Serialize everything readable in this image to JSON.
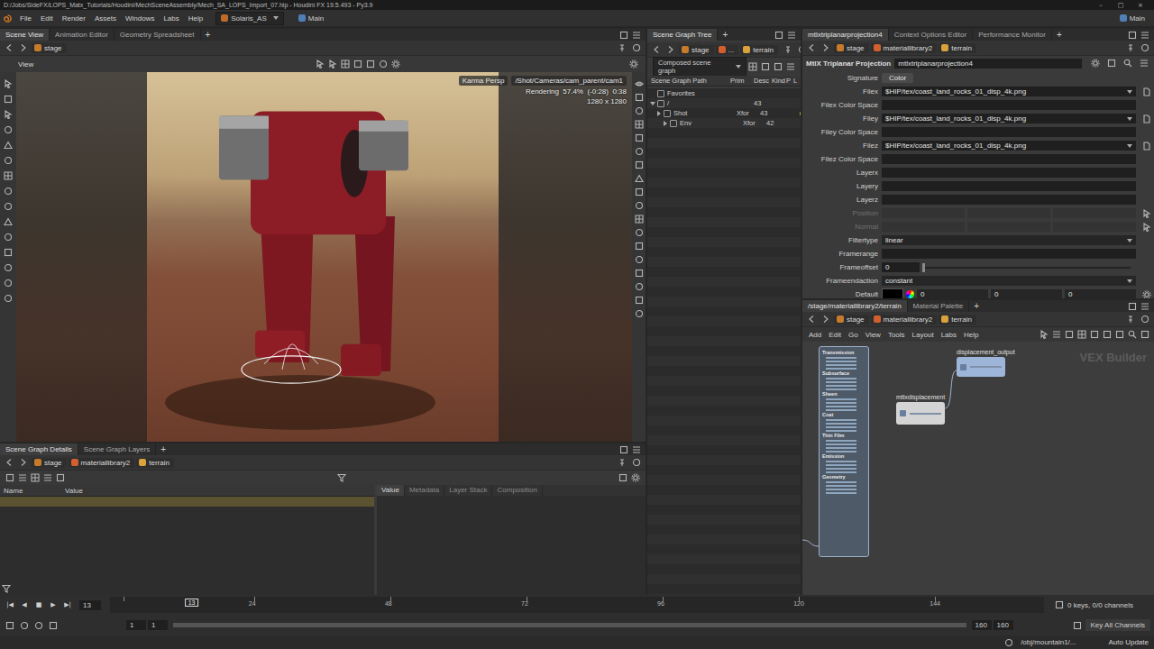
{
  "window": {
    "title": "D:/Jobs/SideFX/LOPS_Matx_Tutorials/Houdini/MechSceneAssembly/Mech_SA_LOPS_Import_07.hip - Houdini FX 19.5.493 - Py3.9",
    "controls": [
      "–",
      "□",
      "×"
    ]
  },
  "menu": {
    "items": [
      "File",
      "Edit",
      "Render",
      "Assets",
      "Windows",
      "Labs",
      "Help"
    ],
    "desktop": "Solaris_AS",
    "workspace": "Main",
    "workspace_right": "Main"
  },
  "scene_view": {
    "tabs": [
      {
        "label": "Scene View",
        "selected": true
      },
      {
        "label": "Animation Editor",
        "selected": false
      },
      {
        "label": "Geometry Spreadsheet",
        "selected": false
      }
    ],
    "add_tab": "+",
    "path": [
      "stage"
    ],
    "toolbar_label": "View",
    "overlay": {
      "camera_mode": "Karma Persp",
      "camera": "/Shot/Cameras/cam_parent/cam1",
      "status": "Rendering  57.4%  (-0:28)  0:38",
      "resolution": "1280 x 1280"
    }
  },
  "scene_graph_details": {
    "tabs": [
      {
        "label": "Scene Graph Details",
        "selected": true
      },
      {
        "label": "Scene Graph Layers",
        "selected": false
      }
    ],
    "add_tab": "+",
    "path": [
      "stage",
      "materiallibrary2",
      "terrain"
    ],
    "columns": [
      "Name",
      "Value"
    ],
    "rows": [
      {
        "name": "",
        "value": "",
        "selected": true
      }
    ],
    "detail_tabs": [
      {
        "label": "Value",
        "selected": true
      },
      {
        "label": "Metadata",
        "selected": false
      },
      {
        "label": "Layer Stack",
        "selected": false
      },
      {
        "label": "Composition",
        "selected": false
      }
    ]
  },
  "scene_graph_tree": {
    "tabs": [
      {
        "label": "Scene Graph Tree",
        "selected": true
      }
    ],
    "add_tab": "+",
    "path": [
      "stage",
      "...",
      "terrain"
    ],
    "mode": "Composed scene graph",
    "columns": [
      "Scene Graph Path",
      "Prim",
      "Desc",
      "Kind",
      "P",
      "L"
    ],
    "rows": [
      {
        "label": "Favorites",
        "depth": 0,
        "expandable": false,
        "expanded": false,
        "prim": "",
        "desc": "",
        "loaded": false
      },
      {
        "label": "/",
        "depth": 0,
        "expandable": true,
        "expanded": true,
        "prim": "",
        "desc": "43",
        "loaded": false
      },
      {
        "label": "Shot",
        "depth": 1,
        "expandable": true,
        "expanded": false,
        "prim": "Xfor",
        "desc": "43",
        "loaded": true
      },
      {
        "label": "Env",
        "depth": 2,
        "expandable": true,
        "expanded": false,
        "prim": "Xfor",
        "desc": "42",
        "loaded": true
      }
    ]
  },
  "parameters": {
    "tabs": [
      {
        "label": "mtlxtriplanarprojection4",
        "selected": true
      },
      {
        "label": "Context Options Editor",
        "selected": false
      },
      {
        "label": "Performance Monitor",
        "selected": false
      }
    ],
    "add_tab": "+",
    "path": [
      "stage",
      "materiallibrary2",
      "terrain"
    ],
    "node_type": "MtlX Triplanar Projection",
    "node_name": "mtlxtriplanarprojection4",
    "params": [
      {
        "label": "Signature",
        "kind": "button",
        "value": "Color",
        "disabled": false
      },
      {
        "label": "Filex",
        "kind": "file",
        "value": "$HIP/tex/coast_land_rocks_01_disp_4k.png",
        "disabled": false
      },
      {
        "label": "Filex Color Space",
        "kind": "text",
        "value": "",
        "disabled": false
      },
      {
        "label": "Filey",
        "kind": "file",
        "value": "$HIP/tex/coast_land_rocks_01_disp_4k.png",
        "disabled": false
      },
      {
        "label": "Filey Color Space",
        "kind": "text",
        "value": "",
        "disabled": false
      },
      {
        "label": "Filez",
        "kind": "file",
        "value": "$HIP/tex/coast_land_rocks_01_disp_4k.png",
        "disabled": false
      },
      {
        "label": "Filez Color Space",
        "kind": "text",
        "value": "",
        "disabled": false
      },
      {
        "label": "Layerx",
        "kind": "text",
        "value": "",
        "disabled": false
      },
      {
        "label": "Layery",
        "kind": "text",
        "value": "",
        "disabled": false
      },
      {
        "label": "Layerz",
        "kind": "text",
        "value": "",
        "disabled": false
      },
      {
        "label": "Position",
        "kind": "vector",
        "values": [
          "",
          "",
          ""
        ],
        "disabled": true
      },
      {
        "label": "Normal",
        "kind": "vector",
        "values": [
          "",
          "",
          ""
        ],
        "disabled": true
      },
      {
        "label": "Filtertype",
        "kind": "menu",
        "value": "linear",
        "disabled": false
      },
      {
        "label": "Framerange",
        "kind": "text",
        "value": "",
        "disabled": false
      },
      {
        "label": "Frameoffset",
        "kind": "slider",
        "value": "0",
        "level": 0,
        "disabled": false
      },
      {
        "label": "Frameendaction",
        "kind": "menu",
        "value": "constant",
        "disabled": false
      },
      {
        "label": "Default",
        "kind": "color",
        "values": [
          "0",
          "0",
          "0"
        ],
        "color": "#000000",
        "disabled": false
      }
    ]
  },
  "network": {
    "tabs": [
      {
        "label": "/stage/materiallibrary2/terrain",
        "selected": true
      },
      {
        "label": "Material Palette",
        "selected": false
      }
    ],
    "add_tab": "+",
    "path": [
      "stage",
      "materiallibrary2",
      "terrain"
    ],
    "menu": [
      "Add",
      "Edit",
      "Go",
      "View",
      "Tools",
      "Layout",
      "Labs",
      "Help"
    ],
    "watermark": "VEX Builder",
    "nodes": [
      {
        "name": "displacement_output",
        "kind": "output"
      },
      {
        "name": "mtlxdisplacement",
        "kind": "op"
      },
      {
        "name": "",
        "kind": "surface",
        "sections": [
          "Transmission",
          "Subsurface",
          "Sheen",
          "Coat",
          "Thin Film",
          "Emission",
          "Geometry"
        ]
      }
    ]
  },
  "timeline": {
    "controls": [
      "|◀",
      "◀",
      "■",
      "▶",
      "▶|"
    ],
    "current_frame": "13",
    "start": "1",
    "end": "160",
    "ticks": [
      "24",
      "48",
      "72",
      "96",
      "120",
      "144"
    ],
    "range_start": "1",
    "range_start_2": "1",
    "range_end": "160",
    "range_end_2": "160",
    "playbar_level": 1,
    "keys": "0 keys, 0/0 channels",
    "key_all": "Key All Channels"
  },
  "status": {
    "path": "/obj/mountain1/...",
    "update_mode": "Auto Update"
  }
}
